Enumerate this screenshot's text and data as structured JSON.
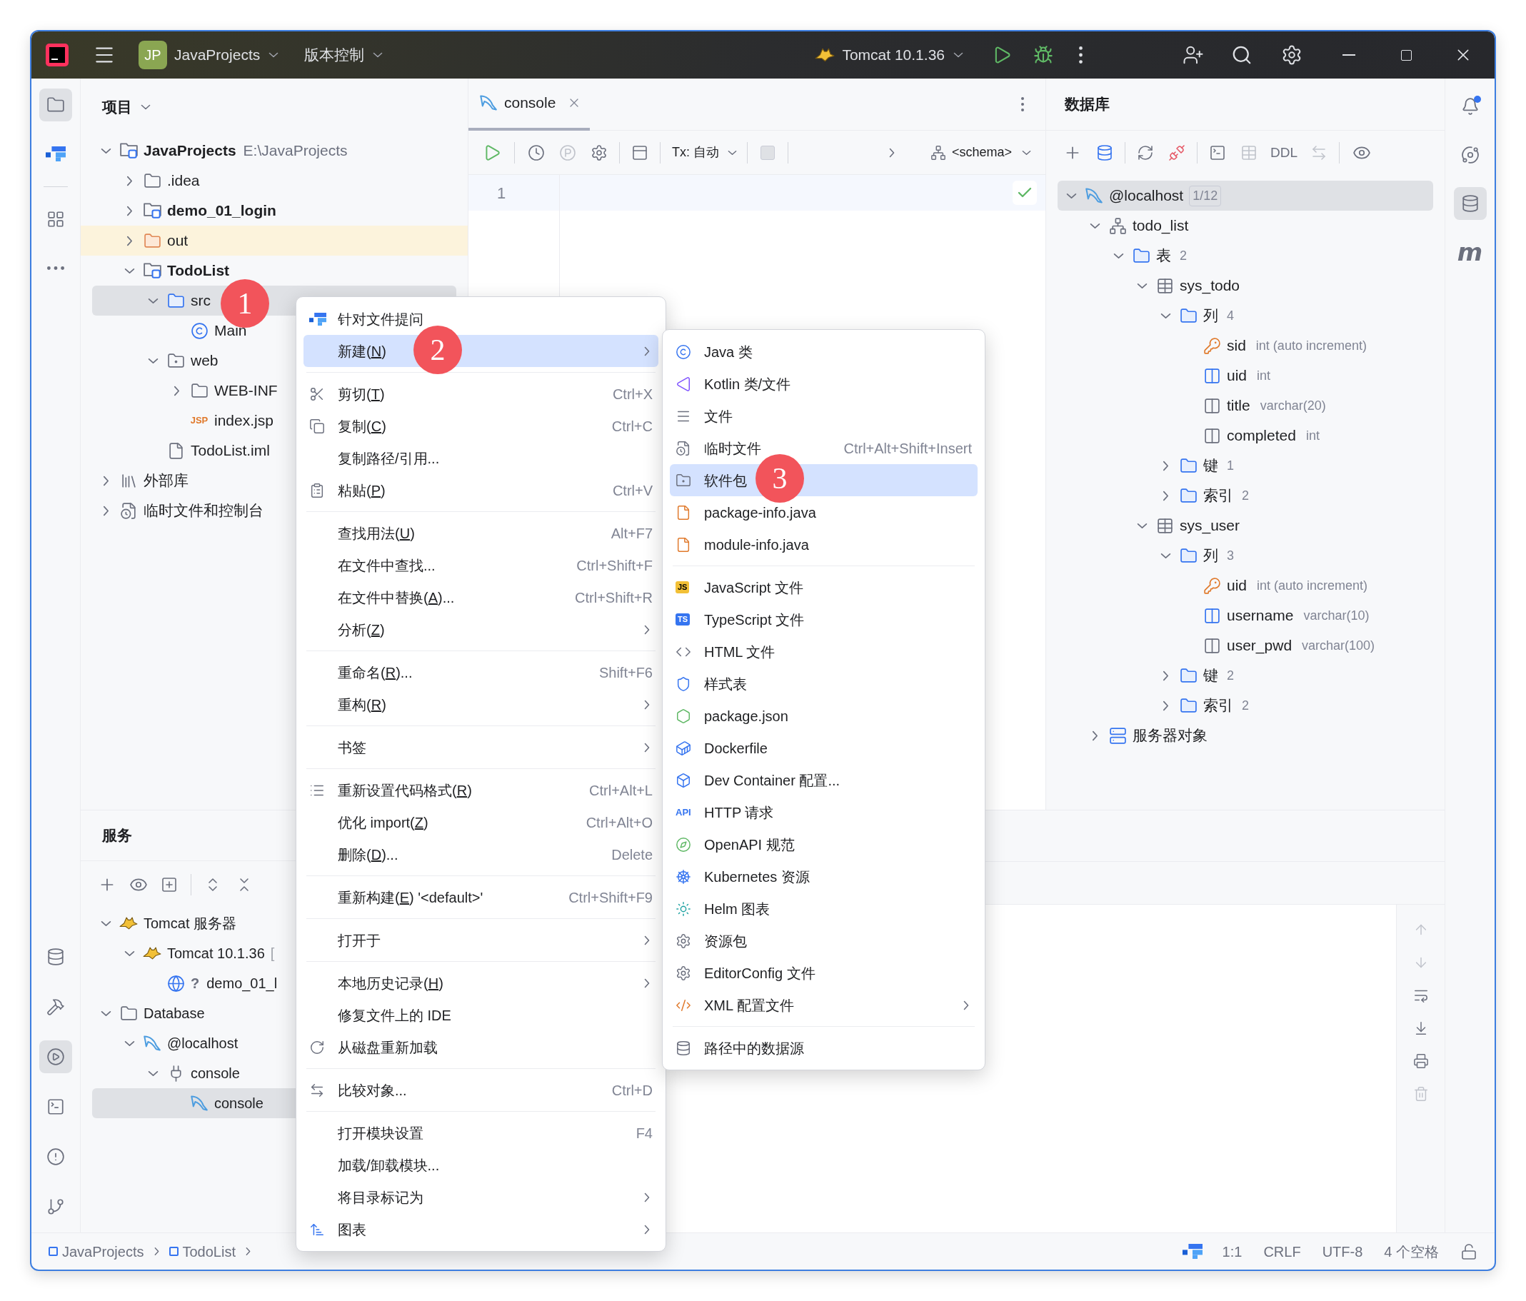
{
  "title_bar": {
    "project_badge": "JP",
    "project": "JavaProjects",
    "vcs": "版本控制",
    "run_config": "Tomcat 10.1.36"
  },
  "left_tools": [
    {
      "kind": "project",
      "selected": true
    },
    {
      "kind": "ai",
      "selected": false
    },
    {
      "kind": "structure",
      "selected": false
    },
    {
      "kind": "more",
      "selected": false
    }
  ],
  "left_tools_bottom": [
    {
      "kind": "database",
      "selected": false
    },
    {
      "kind": "build",
      "selected": false
    },
    {
      "kind": "services",
      "selected": true
    },
    {
      "kind": "terminal",
      "selected": false
    },
    {
      "kind": "problems",
      "selected": false
    },
    {
      "kind": "git",
      "selected": false
    }
  ],
  "right_tools": [
    {
      "kind": "notifications",
      "selected": false,
      "unread": true
    },
    {
      "kind": "swirl",
      "selected": false
    },
    {
      "kind": "database",
      "selected": true
    },
    {
      "kind": "letter",
      "label": "m",
      "selected": false
    }
  ],
  "project_panel": {
    "title": "项目",
    "tree": [
      {
        "label": "JavaProjects",
        "kind": "module",
        "path": "E:\\JavaProjects",
        "expanded": true,
        "selected": false,
        "children": [
          {
            "label": ".idea",
            "kind": "folder",
            "expanded": false,
            "selected": false
          },
          {
            "label": "demo_01_login",
            "kind": "module",
            "expanded": false,
            "selected": false
          },
          {
            "label": "out",
            "kind": "excluded",
            "expanded": false,
            "selected": false
          },
          {
            "label": "TodoList",
            "kind": "module",
            "expanded": true,
            "selected": false,
            "children": [
              {
                "label": "src",
                "kind": "source",
                "expanded": true,
                "selected": true,
                "children": [
                  {
                    "label": "Main",
                    "kind": "class",
                    "selected": false
                  }
                ]
              },
              {
                "label": "web",
                "kind": "web",
                "expanded": true,
                "selected": false,
                "children": [
                  {
                    "label": "WEB-INF",
                    "kind": "folder",
                    "expanded": false,
                    "selected": false
                  },
                  {
                    "label": "index.jsp",
                    "kind": "jsp",
                    "badge": "JSP",
                    "selected": false
                  }
                ]
              },
              {
                "label": "TodoList.iml",
                "kind": "iml",
                "selected": false
              }
            ]
          }
        ]
      },
      {
        "label": "外部库",
        "kind": "library",
        "expanded": false,
        "selected": false
      },
      {
        "label": "临时文件和控制台",
        "kind": "scratch",
        "expanded": false,
        "selected": false
      }
    ]
  },
  "editor": {
    "tab": {
      "label": "console",
      "selected": true
    },
    "tx": "Tx: 自动",
    "schema": "<schema>",
    "lines": [
      "1"
    ]
  },
  "database_panel": {
    "title": "数据库",
    "ddl": "DDL",
    "tree": [
      {
        "label": "@localhost",
        "kind": "datasource",
        "badge": "1/12",
        "expanded": true,
        "selected": true,
        "children": [
          {
            "label": "todo_list",
            "kind": "schema",
            "expanded": true,
            "selected": false,
            "children": [
              {
                "label": "表",
                "count": "2",
                "kind": "dbfolder",
                "expanded": true,
                "selected": false,
                "children": [
                  {
                    "label": "sys_todo",
                    "kind": "table",
                    "expanded": true,
                    "selected": false,
                    "children": [
                      {
                        "label": "列",
                        "count": "4",
                        "kind": "dbfolder",
                        "expanded": true,
                        "selected": false,
                        "children": [
                          {
                            "label": "sid",
                            "type": "int (auto increment)",
                            "kind": "pk",
                            "selected": false
                          },
                          {
                            "label": "uid",
                            "type": "int",
                            "kind": "notnull",
                            "selected": false
                          },
                          {
                            "label": "title",
                            "type": "varchar(20)",
                            "kind": "column",
                            "selected": false
                          },
                          {
                            "label": "completed",
                            "type": "int",
                            "kind": "column",
                            "selected": false
                          }
                        ]
                      },
                      {
                        "label": "键",
                        "count": "1",
                        "kind": "dbfolder",
                        "expanded": false,
                        "selected": false
                      },
                      {
                        "label": "索引",
                        "count": "2",
                        "kind": "dbfolder",
                        "expanded": false,
                        "selected": false
                      }
                    ]
                  },
                  {
                    "label": "sys_user",
                    "kind": "table",
                    "expanded": true,
                    "selected": false,
                    "children": [
                      {
                        "label": "列",
                        "count": "3",
                        "kind": "dbfolder",
                        "expanded": true,
                        "selected": false,
                        "children": [
                          {
                            "label": "uid",
                            "type": "int (auto increment)",
                            "kind": "pk",
                            "selected": false
                          },
                          {
                            "label": "username",
                            "type": "varchar(10)",
                            "kind": "notnull",
                            "selected": false
                          },
                          {
                            "label": "user_pwd",
                            "type": "varchar(100)",
                            "kind": "column",
                            "selected": false
                          }
                        ]
                      },
                      {
                        "label": "键",
                        "count": "2",
                        "kind": "dbfolder",
                        "expanded": false,
                        "selected": false
                      },
                      {
                        "label": "索引",
                        "count": "2",
                        "kind": "dbfolder",
                        "expanded": false,
                        "selected": false
                      }
                    ]
                  }
                ]
              }
            ]
          },
          {
            "label": "服务器对象",
            "kind": "server_objects",
            "expanded": false,
            "selected": false
          }
        ]
      }
    ]
  },
  "services_panel": {
    "title": "服务",
    "tree": [
      {
        "label": "Tomcat 服务器",
        "kind": "tomcat",
        "expanded": true,
        "selected": false,
        "children": [
          {
            "label": "Tomcat 10.1.36",
            "suffix": "[",
            "kind": "tomcat",
            "expanded": true,
            "selected": false,
            "children": [
              {
                "label": "demo_01_l",
                "status": "?",
                "kind": "artifact",
                "selected": false
              }
            ]
          }
        ]
      },
      {
        "label": "Database",
        "kind": "folder",
        "expanded": true,
        "selected": false,
        "children": [
          {
            "label": "@localhost",
            "kind": "datasource",
            "expanded": true,
            "selected": false,
            "children": [
              {
                "label": "console",
                "kind": "session",
                "expanded": true,
                "selected": false,
                "children": [
                  {
                    "label": "console",
                    "kind": "datasource",
                    "selected": true
                  }
                ]
              }
            ]
          }
        ]
      }
    ]
  },
  "context_menu": [
    {
      "kind": "ai",
      "label": "针对文件提问",
      "submenu": false,
      "selected": false
    },
    {
      "kind": "plain",
      "label": "新建(N)",
      "submenu": true,
      "selected": true
    },
    {
      "kind": "separator"
    },
    {
      "kind": "cut",
      "label": "剪切(T)",
      "shortcut": "Ctrl+X",
      "submenu": false,
      "selected": false
    },
    {
      "kind": "copy",
      "label": "复制(C)",
      "shortcut": "Ctrl+C",
      "submenu": false,
      "selected": false
    },
    {
      "kind": "plain",
      "label": "复制路径/引用...",
      "submenu": false,
      "selected": false
    },
    {
      "kind": "paste",
      "label": "粘贴(P)",
      "shortcut": "Ctrl+V",
      "submenu": false,
      "selected": false
    },
    {
      "kind": "separator"
    },
    {
      "kind": "plain",
      "label": "查找用法(U)",
      "shortcut": "Alt+F7",
      "submenu": false,
      "selected": false
    },
    {
      "kind": "plain",
      "label": "在文件中查找...",
      "shortcut": "Ctrl+Shift+F",
      "submenu": false,
      "selected": false
    },
    {
      "kind": "plain",
      "label": "在文件中替换(A)...",
      "shortcut": "Ctrl+Shift+R",
      "submenu": false,
      "selected": false
    },
    {
      "kind": "plain",
      "label": "分析(Z)",
      "submenu": true,
      "selected": false
    },
    {
      "kind": "separator"
    },
    {
      "kind": "plain",
      "label": "重命名(R)...",
      "shortcut": "Shift+F6",
      "submenu": false,
      "selected": false
    },
    {
      "kind": "plain",
      "label": "重构(R)",
      "submenu": true,
      "selected": false
    },
    {
      "kind": "separator"
    },
    {
      "kind": "plain",
      "label": "书签",
      "submenu": true,
      "selected": false
    },
    {
      "kind": "separator"
    },
    {
      "kind": "format",
      "label": "重新设置代码格式(R)",
      "shortcut": "Ctrl+Alt+L",
      "submenu": false,
      "selected": false
    },
    {
      "kind": "plain",
      "label": "优化 import(Z)",
      "shortcut": "Ctrl+Alt+O",
      "submenu": false,
      "selected": false
    },
    {
      "kind": "plain",
      "label": "删除(D)...",
      "shortcut": "Delete",
      "submenu": false,
      "selected": false
    },
    {
      "kind": "separator"
    },
    {
      "kind": "plain",
      "label": "重新构建(E) '<default>'",
      "shortcut": "Ctrl+Shift+F9",
      "submenu": false,
      "selected": false
    },
    {
      "kind": "separator"
    },
    {
      "kind": "plain",
      "label": "打开于",
      "submenu": true,
      "selected": false
    },
    {
      "kind": "separator"
    },
    {
      "kind": "plain",
      "label": "本地历史记录(H)",
      "submenu": true,
      "selected": false
    },
    {
      "kind": "plain",
      "label": "修复文件上的 IDE",
      "submenu": false,
      "selected": false
    },
    {
      "kind": "reload",
      "label": "从磁盘重新加载",
      "submenu": false,
      "selected": false
    },
    {
      "kind": "separator"
    },
    {
      "kind": "compare",
      "label": "比较对象...",
      "shortcut": "Ctrl+D",
      "submenu": false,
      "selected": false
    },
    {
      "kind": "separator"
    },
    {
      "kind": "plain",
      "label": "打开模块设置",
      "shortcut": "F4",
      "submenu": false,
      "selected": false
    },
    {
      "kind": "plain",
      "label": "加载/卸载模块...",
      "submenu": false,
      "selected": false
    },
    {
      "kind": "plain",
      "label": "将目录标记为",
      "submenu": true,
      "selected": false
    },
    {
      "kind": "diagram",
      "label": "图表",
      "submenu": true,
      "selected": false
    }
  ],
  "new_submenu": [
    {
      "kind": "java_class",
      "label": "Java 类",
      "submenu": false,
      "selected": false
    },
    {
      "kind": "kotlin",
      "label": "Kotlin 类/文件",
      "submenu": false,
      "selected": false
    },
    {
      "kind": "text",
      "label": "文件",
      "submenu": false,
      "selected": false
    },
    {
      "kind": "scratch",
      "label": "临时文件",
      "shortcut": "Ctrl+Alt+Shift+Insert",
      "submenu": false,
      "selected": false
    },
    {
      "kind": "package",
      "label": "软件包",
      "submenu": false,
      "selected": true
    },
    {
      "kind": "java_file",
      "label": "package-info.java",
      "submenu": false,
      "selected": false
    },
    {
      "kind": "java_file",
      "label": "module-info.java",
      "submenu": false,
      "selected": false
    },
    {
      "kind": "separator"
    },
    {
      "kind": "js",
      "badge": "JS",
      "label": "JavaScript 文件",
      "submenu": false,
      "selected": false
    },
    {
      "kind": "ts",
      "badge": "TS",
      "label": "TypeScript 文件",
      "submenu": false,
      "selected": false
    },
    {
      "kind": "html",
      "label": "HTML 文件",
      "submenu": false,
      "selected": false
    },
    {
      "kind": "css",
      "label": "样式表",
      "submenu": false,
      "selected": false
    },
    {
      "kind": "npm",
      "label": "package.json",
      "submenu": false,
      "selected": false
    },
    {
      "kind": "docker",
      "label": "Dockerfile",
      "submenu": false,
      "selected": false
    },
    {
      "kind": "devcontainer",
      "label": "Dev Container 配置...",
      "submenu": false,
      "selected": false
    },
    {
      "kind": "api",
      "badge": "API",
      "label": "HTTP 请求",
      "submenu": false,
      "selected": false
    },
    {
      "kind": "openapi",
      "label": "OpenAPI 规范",
      "submenu": false,
      "selected": false
    },
    {
      "kind": "kubernetes",
      "label": "Kubernetes 资源",
      "submenu": false,
      "selected": false
    },
    {
      "kind": "helm",
      "label": "Helm 图表",
      "submenu": false,
      "selected": false
    },
    {
      "kind": "gear",
      "label": "资源包",
      "submenu": false,
      "selected": false
    },
    {
      "kind": "gear",
      "label": "EditorConfig 文件",
      "submenu": false,
      "selected": false
    },
    {
      "kind": "xml",
      "label": "XML 配置文件",
      "submenu": true,
      "selected": false
    },
    {
      "kind": "separator"
    },
    {
      "kind": "database",
      "label": "路径中的数据源",
      "submenu": false,
      "selected": false
    }
  ],
  "step_markers": [
    "1",
    "2",
    "3"
  ],
  "status_bar": {
    "breadcrumbs": [
      "JavaProjects",
      "TodoList"
    ],
    "position": "1:1",
    "line_ending": "CRLF",
    "encoding": "UTF-8",
    "indent": "4 个空格"
  }
}
